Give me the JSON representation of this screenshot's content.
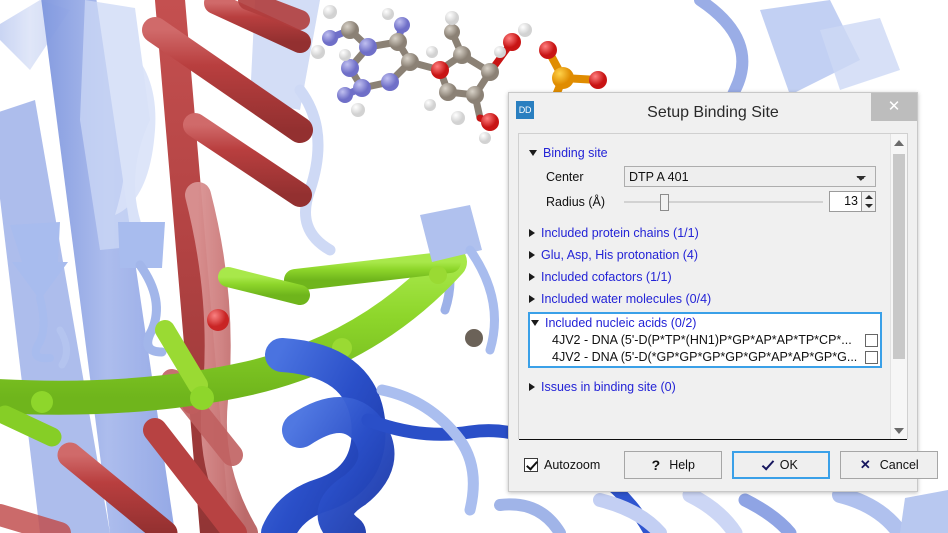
{
  "window": {
    "title": "Setup Binding Site",
    "app_icon_text": "DD",
    "close_label": "✕"
  },
  "sections": {
    "binding_site": {
      "label": "Binding site",
      "expanded": true,
      "center_label": "Center",
      "center_value": "DTP A 401",
      "center_options": [
        "DTP A 401"
      ],
      "radius_label": "Radius (Å)",
      "radius_value": "13",
      "radius_slider_percent": 18
    },
    "collapsed": [
      {
        "label": "Included protein chains (1/1)"
      },
      {
        "label": "Glu, Asp, His protonation (4)"
      },
      {
        "label": "Included cofactors (1/1)"
      },
      {
        "label": "Included water molecules (0/4)"
      }
    ],
    "nucleic_acids": {
      "label": "Included nucleic acids (0/2)",
      "expanded": true,
      "rows": [
        {
          "text": "4JV2 - DNA (5'-D(P*TP*(HN1)P*GP*AP*AP*TP*CP*...",
          "checked": false
        },
        {
          "text": "4JV2 - DNA (5'-D(*GP*GP*GP*GP*GP*AP*AP*GP*G...",
          "checked": false
        }
      ]
    },
    "issues": {
      "label": "Issues in binding site (0)"
    }
  },
  "footer": {
    "autozoom_label": "Autozoom",
    "autozoom_checked": true,
    "help_label": "Help",
    "help_glyph": "?",
    "ok_label": "OK",
    "cancel_label": "Cancel",
    "cancel_glyph": "✕"
  },
  "colors": {
    "link": "#2323d6",
    "focus_blue": "#3aa0e8",
    "app_icon_bg": "#2a7fc0",
    "dialog_bg": "#f0f0f0",
    "glyph_navy": "#16165e",
    "protein_sheet_blue": "#9aaee8",
    "protein_helix_blue": "#2f55cf",
    "protein_helix_red": "#bb4444",
    "dna_green": "#8ed62b",
    "ligand_carbon": "#9b9183",
    "ligand_nitrogen": "#8c8cdc",
    "ligand_oxygen": "#e02020",
    "ligand_phosphorus": "#f0a000",
    "ligand_hydrogen": "#f4f4f4"
  },
  "scene": {
    "description": "3D protein-DNA complex with ball-and-stick ligand",
    "background": "#ffffff"
  }
}
